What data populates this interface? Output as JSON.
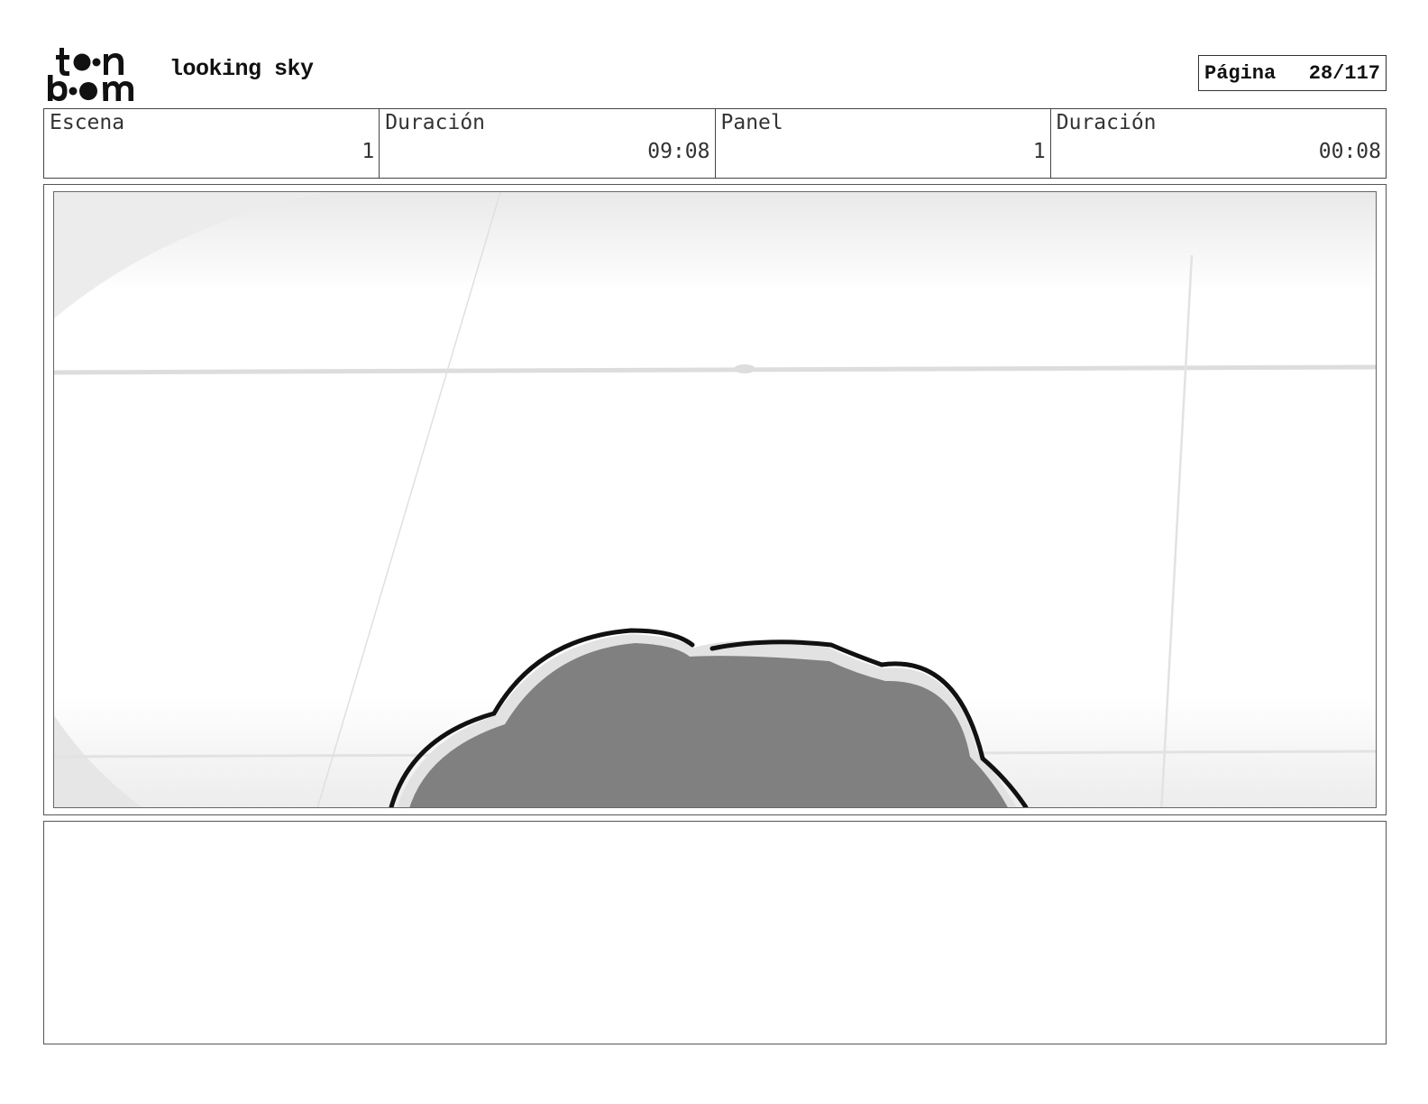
{
  "header": {
    "project_title": "looking sky",
    "page_label": "Página",
    "page_number": "28/117"
  },
  "info": {
    "scene_label": "Escena",
    "scene_value": "1",
    "scene_duration_label": "Duración",
    "scene_duration_value": "09:08",
    "panel_label": "Panel",
    "panel_value": "1",
    "panel_duration_label": "Duración",
    "panel_duration_value": "00:08"
  },
  "colors": {
    "ink": "#111111",
    "cloud_fill": "#808080",
    "cloud_highlight": "#e2e2e2",
    "background": "#ffffff"
  }
}
